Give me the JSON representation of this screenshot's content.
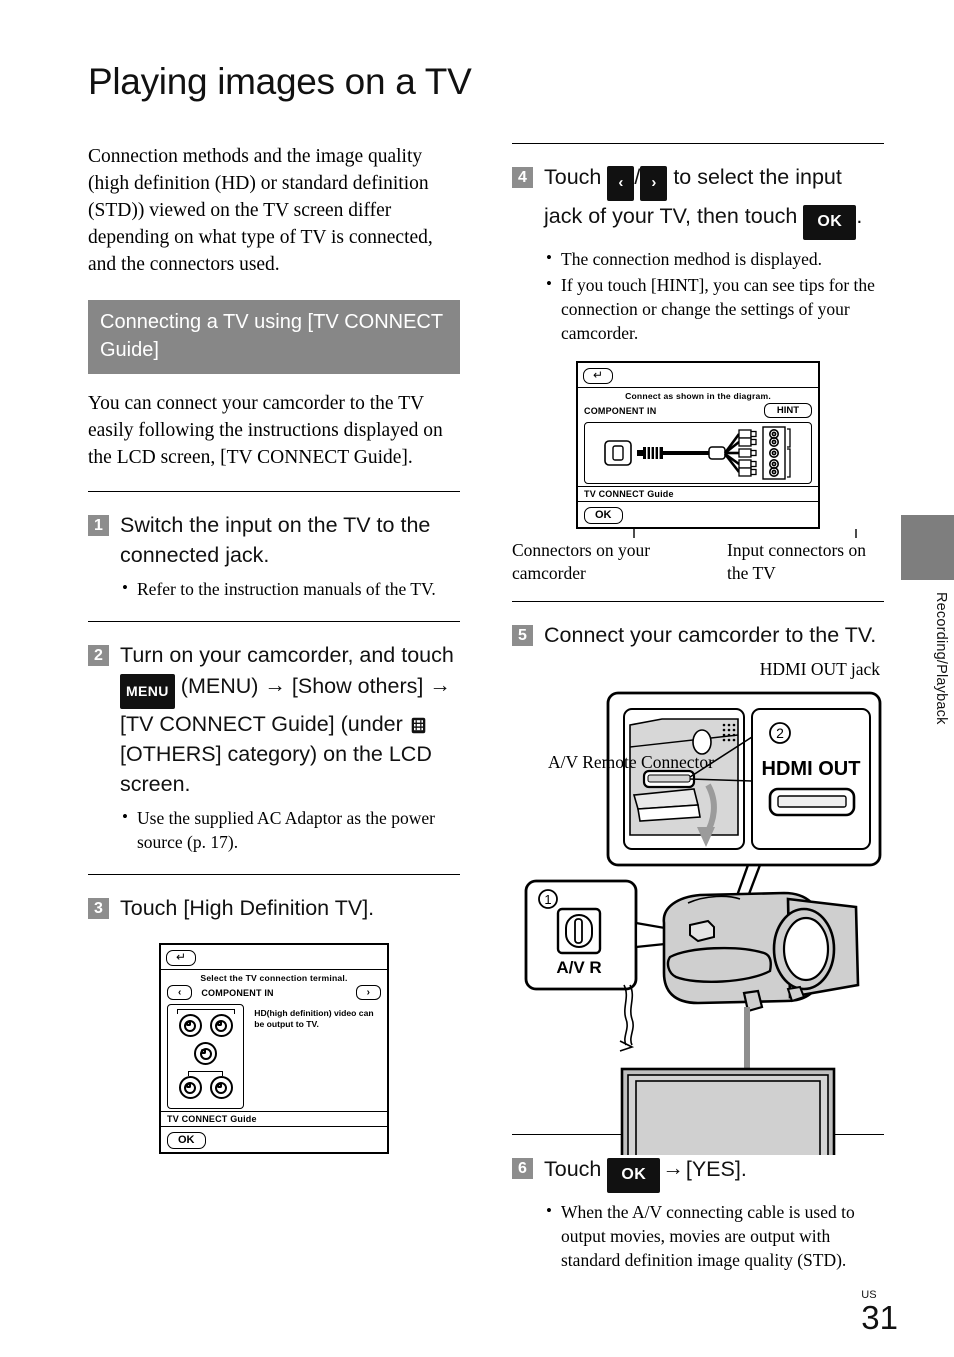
{
  "page": {
    "title": "Playing images on a TV",
    "footer_region": "US",
    "footer_number": "31",
    "side_tab_label": "Recording/Playback",
    "band_color": "#878787",
    "step_num_color": "#8d8d8d"
  },
  "left": {
    "intro": "Connection methods and the image quality (high definition (HD) or standard definition (STD)) viewed on the TV screen differ depending on what type of TV is connected, and the connectors used.",
    "section_heading": "Connecting a TV using [TV CONNECT Guide]",
    "section_para": "You can connect your camcorder to the TV easily following the instructions displayed on the LCD screen, [TV CONNECT Guide].",
    "steps": [
      {
        "num": "1",
        "title": "Switch the input on the TV to the connected jack.",
        "bullets": [
          "Refer to the instruction manuals of the TV."
        ]
      },
      {
        "num": "2",
        "title_part1": "Turn on your camcorder, and touch ",
        "key_menu": "MENU",
        "title_part2": " (MENU) ",
        "arrow1": "→",
        "title_part3": " [Show others] ",
        "arrow2": "→",
        "title_part4": " [TV CONNECT Guide] (under ",
        "icon_others": "others-icon",
        "title_part5": " [OTHERS] category) on the LCD screen.",
        "bullets": [
          "Use the supplied AC Adaptor as the power source (p. 17)."
        ]
      },
      {
        "num": "3",
        "title": "Touch [High Definition TV].",
        "bullets": []
      }
    ],
    "lcd_step3": {
      "back_icon": "back-arrow-icon",
      "caption": "Select the TV connection terminal.",
      "prev_icon": "‹",
      "terminal": "COMPONENT IN",
      "next_icon": "›",
      "description": "HD(high definition) video can be output to TV.",
      "footer": "TV CONNECT Guide",
      "ok": "OK"
    }
  },
  "right": {
    "steps": [
      {
        "num": "4",
        "title_part1": "Touch ",
        "key_left": "‹",
        "sep": "/",
        "key_right": "›",
        "title_part2": " to select the input jack of your TV, then touch ",
        "key_ok": "OK",
        "title_part3": ".",
        "bullets": [
          "The connection medhod is displayed.",
          "If you touch [HINT], you can see tips for the connection or change the settings of your camcorder."
        ]
      },
      {
        "num": "5",
        "title": "Connect your camcorder to the TV.",
        "bullets": []
      },
      {
        "num": "6",
        "title_part1": "Touch ",
        "key_ok": "OK",
        "arrow": "→",
        "title_part2": "[YES].",
        "bullets": [
          "When the A/V connecting cable is used to output movies, movies are output with standard definition image quality (STD)."
        ]
      }
    ],
    "lcd_step4": {
      "back_icon": "back-arrow-icon",
      "caption": "Connect as shown in the diagram.",
      "terminal": "COMPONENT IN",
      "hint": "HINT",
      "footer": "TV CONNECT Guide",
      "ok": "OK"
    },
    "diagram_labels": {
      "camcorder_connectors": "Connectors on your camcorder",
      "tv_connectors": "Input connectors on the TV",
      "hdmi_out_jack": "HDMI OUT jack",
      "hdmi_callout_number": "2",
      "hdmi_callout_label": "HDMI OUT",
      "avr_callout_number": "1",
      "avr_callout_label": "A/V R",
      "avr_label": "A/V Remote Connector"
    }
  }
}
